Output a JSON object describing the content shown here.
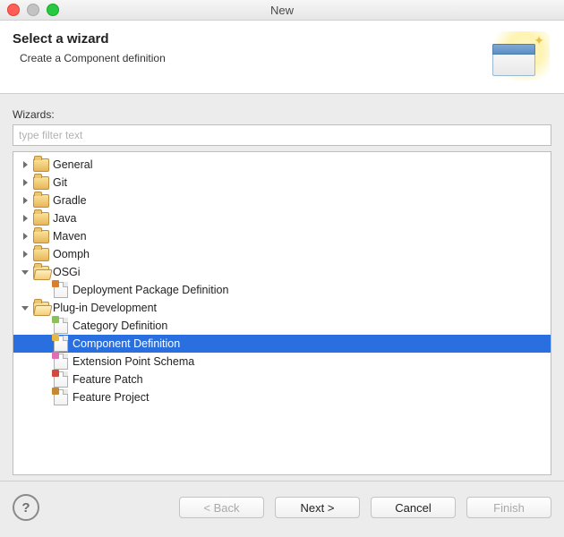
{
  "window": {
    "title": "New"
  },
  "banner": {
    "heading": "Select a wizard",
    "description": "Create a Component definition"
  },
  "body": {
    "list_label": "Wizards:",
    "filter_placeholder": "type filter text"
  },
  "tree": {
    "nodes": [
      {
        "id": "general",
        "depth": 0,
        "expanded": false,
        "expandable": true,
        "icon": "folder-closed",
        "label": "General"
      },
      {
        "id": "git",
        "depth": 0,
        "expanded": false,
        "expandable": true,
        "icon": "folder-closed",
        "label": "Git"
      },
      {
        "id": "gradle",
        "depth": 0,
        "expanded": false,
        "expandable": true,
        "icon": "folder-closed",
        "label": "Gradle"
      },
      {
        "id": "java",
        "depth": 0,
        "expanded": false,
        "expandable": true,
        "icon": "folder-closed",
        "label": "Java"
      },
      {
        "id": "maven",
        "depth": 0,
        "expanded": false,
        "expandable": true,
        "icon": "folder-closed",
        "label": "Maven"
      },
      {
        "id": "oomph",
        "depth": 0,
        "expanded": false,
        "expandable": true,
        "icon": "folder-closed",
        "label": "Oomph"
      },
      {
        "id": "osgi",
        "depth": 0,
        "expanded": true,
        "expandable": true,
        "icon": "folder-open",
        "label": "OSGi"
      },
      {
        "id": "dpp",
        "depth": 1,
        "expanded": false,
        "expandable": false,
        "icon": "doc-dpp",
        "label": "Deployment Package Definition"
      },
      {
        "id": "pde",
        "depth": 0,
        "expanded": true,
        "expandable": true,
        "icon": "folder-open",
        "label": "Plug-in Development"
      },
      {
        "id": "cat",
        "depth": 1,
        "expanded": false,
        "expandable": false,
        "icon": "doc-cat",
        "label": "Category Definition"
      },
      {
        "id": "comp",
        "depth": 1,
        "expanded": false,
        "expandable": false,
        "icon": "doc-comp",
        "label": "Component Definition",
        "selected": true
      },
      {
        "id": "ext",
        "depth": 1,
        "expanded": false,
        "expandable": false,
        "icon": "doc-ext",
        "label": "Extension Point Schema"
      },
      {
        "id": "featpatch",
        "depth": 1,
        "expanded": false,
        "expandable": false,
        "icon": "doc-feat",
        "label": "Feature Patch"
      },
      {
        "id": "featproj",
        "depth": 1,
        "expanded": false,
        "expandable": false,
        "icon": "doc-featp",
        "label": "Feature Project"
      }
    ]
  },
  "footer": {
    "back": {
      "label": "< Back",
      "enabled": false
    },
    "next": {
      "label": "Next >",
      "enabled": true
    },
    "cancel": {
      "label": "Cancel",
      "enabled": true
    },
    "finish": {
      "label": "Finish",
      "enabled": false
    }
  }
}
